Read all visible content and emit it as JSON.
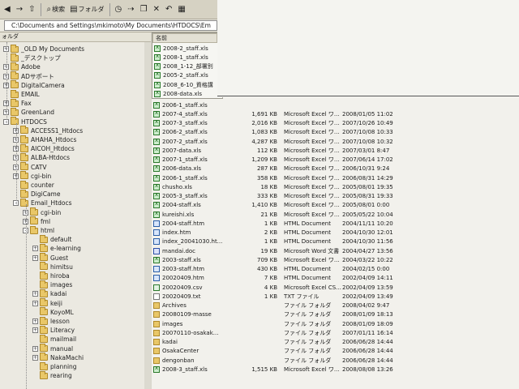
{
  "toolbar": {
    "back_label": "",
    "search_label": "検索",
    "folders_label": "フォルダ"
  },
  "address": {
    "label": "",
    "value": "C:\\Documents and Settings\\mkimoto\\My Documents\\HTDOCS\\Em"
  },
  "tree": {
    "header": "ォルダ",
    "items": [
      {
        "label": "_OLD My Documents",
        "indent": 0,
        "expander": "+"
      },
      {
        "label": "_デスクトップ",
        "indent": 0,
        "expander": ""
      },
      {
        "label": "Adobe",
        "indent": 0,
        "expander": "+"
      },
      {
        "label": "ADサポート",
        "indent": 0,
        "expander": "+"
      },
      {
        "label": "DigitalCamera",
        "indent": 0,
        "expander": "+"
      },
      {
        "label": "EMAIL",
        "indent": 0,
        "expander": ""
      },
      {
        "label": "Fax",
        "indent": 0,
        "expander": "+"
      },
      {
        "label": "GreenLand",
        "indent": 0,
        "expander": "+"
      },
      {
        "label": "HTDOCS",
        "indent": 0,
        "expander": "-"
      },
      {
        "label": "ACCESS1_Htdocs",
        "indent": 1,
        "expander": "+"
      },
      {
        "label": "AHAHA_Htdocs",
        "indent": 1,
        "expander": "+"
      },
      {
        "label": "AICOH_Htdocs",
        "indent": 1,
        "expander": "+"
      },
      {
        "label": "ALBA-Htdocs",
        "indent": 1,
        "expander": "+"
      },
      {
        "label": "CATV",
        "indent": 1,
        "expander": "+"
      },
      {
        "label": "cgi-bin",
        "indent": 1,
        "expander": "+"
      },
      {
        "label": "counter",
        "indent": 1,
        "expander": ""
      },
      {
        "label": "DigiCame",
        "indent": 1,
        "expander": ""
      },
      {
        "label": "Email_Htdocs",
        "indent": 1,
        "expander": "-"
      },
      {
        "label": "cgi-bin",
        "indent": 2,
        "expander": "+"
      },
      {
        "label": "fml",
        "indent": 2,
        "expander": "+"
      },
      {
        "label": "html",
        "indent": 2,
        "expander": "-"
      },
      {
        "label": "default",
        "indent": 3,
        "expander": ""
      },
      {
        "label": "e-learning",
        "indent": 3,
        "expander": "+"
      },
      {
        "label": "Guest",
        "indent": 3,
        "expander": "+"
      },
      {
        "label": "himitsu",
        "indent": 3,
        "expander": ""
      },
      {
        "label": "hiroba",
        "indent": 3,
        "expander": ""
      },
      {
        "label": "images",
        "indent": 3,
        "expander": ""
      },
      {
        "label": "kadai",
        "indent": 3,
        "expander": "+"
      },
      {
        "label": "keiji",
        "indent": 3,
        "expander": "+"
      },
      {
        "label": "KoyoML",
        "indent": 3,
        "expander": ""
      },
      {
        "label": "lesson",
        "indent": 3,
        "expander": "+"
      },
      {
        "label": "Literacy",
        "indent": 3,
        "expander": "+"
      },
      {
        "label": "mailmail",
        "indent": 3,
        "expander": ""
      },
      {
        "label": "manual",
        "indent": 3,
        "expander": "+"
      },
      {
        "label": "NakaMachi",
        "indent": 3,
        "expander": "+"
      },
      {
        "label": "planning",
        "indent": 3,
        "expander": ""
      },
      {
        "label": "rearing",
        "indent": 3,
        "expander": ""
      }
    ]
  },
  "list": {
    "header_name": "名前",
    "overlay_files": [
      "2008-2_staff.xls",
      "2008-1_staff.xls",
      "2008_1-12_部署別",
      "2005-2_staff.xls",
      "2008_6-10_資格講",
      "2008-data.xls"
    ],
    "rows": [
      {
        "icon": "xls",
        "name": "2006-1_staff.xls",
        "size": "",
        "type": "",
        "date": ""
      },
      {
        "icon": "xls",
        "name": "2007-4_staff.xls",
        "size": "1,691 KB",
        "type": "Microsoft Excel ワ...",
        "date": "2008/01/05 11:02"
      },
      {
        "icon": "xls",
        "name": "2007-3_staff.xls",
        "size": "2,016 KB",
        "type": "Microsoft Excel ワ...",
        "date": "2007/10/26 10:49"
      },
      {
        "icon": "xls",
        "name": "2006-2_staff.xls",
        "size": "1,083 KB",
        "type": "Microsoft Excel ワ...",
        "date": "2007/10/08 10:33"
      },
      {
        "icon": "xls",
        "name": "2007-2_staff.xls",
        "size": "4,287 KB",
        "type": "Microsoft Excel ワ...",
        "date": "2007/10/08 10:32"
      },
      {
        "icon": "xls",
        "name": "2007-data.xls",
        "size": "112 KB",
        "type": "Microsoft Excel ワ...",
        "date": "2007/03/01 8:47"
      },
      {
        "icon": "xls",
        "name": "2007-1_staff.xls",
        "size": "1,209 KB",
        "type": "Microsoft Excel ワ...",
        "date": "2007/06/14 17:02"
      },
      {
        "icon": "xls",
        "name": "2006-data.xls",
        "size": "287 KB",
        "type": "Microsoft Excel ワ...",
        "date": "2006/10/31 9:24"
      },
      {
        "icon": "xls",
        "name": "2006-1_staff.xls",
        "size": "358 KB",
        "type": "Microsoft Excel ワ...",
        "date": "2006/08/31 14:29"
      },
      {
        "icon": "xls",
        "name": "chusho.xls",
        "size": "18 KB",
        "type": "Microsoft Excel ワ...",
        "date": "2005/08/01 19:35"
      },
      {
        "icon": "xls",
        "name": "2005-3_staff.xls",
        "size": "333 KB",
        "type": "Microsoft Excel ワ...",
        "date": "2005/08/31 19:33"
      },
      {
        "icon": "xls",
        "name": "2004-staff.xls",
        "size": "1,410 KB",
        "type": "Microsoft Excel ワ...",
        "date": "2005/08/01 0:00"
      },
      {
        "icon": "xls",
        "name": "kureishi.xls",
        "size": "21 KB",
        "type": "Microsoft Excel ワ...",
        "date": "2005/05/22 10:04"
      },
      {
        "icon": "htm",
        "name": "2004-staff.htm",
        "size": "1 KB",
        "type": "HTML Document",
        "date": "2004/11/11 10:20"
      },
      {
        "icon": "htm",
        "name": "index.htm",
        "size": "2 KB",
        "type": "HTML Document",
        "date": "2004/10/30 12:01"
      },
      {
        "icon": "htm",
        "name": "index_20041030.ht...",
        "size": "1 KB",
        "type": "HTML Document",
        "date": "2004/10/30 11:56"
      },
      {
        "icon": "doc",
        "name": "mandai.doc",
        "size": "19 KB",
        "type": "Microsoft Word 文書",
        "date": "2004/04/27 13:56"
      },
      {
        "icon": "xls",
        "name": "2003-staff.xls",
        "size": "709 KB",
        "type": "Microsoft Excel ワ...",
        "date": "2004/03/22 10:22"
      },
      {
        "icon": "htm",
        "name": "2003-staff.htm",
        "size": "430 KB",
        "type": "HTML Document",
        "date": "2004/02/15 0:00"
      },
      {
        "icon": "htm",
        "name": "20020409.htm",
        "size": "7 KB",
        "type": "HTML Document",
        "date": "2002/04/09 14:11"
      },
      {
        "icon": "csv",
        "name": "20020409.csv",
        "size": "4 KB",
        "type": "Microsoft Excel CS...",
        "date": "2002/04/09 13:59"
      },
      {
        "icon": "txt",
        "name": "20020409.txt",
        "size": "1 KB",
        "type": "TXT ファイル",
        "date": "2002/04/09 13:49"
      },
      {
        "icon": "folder2",
        "name": "Archives",
        "size": "",
        "type": "ファイル フォルダ",
        "date": "2008/04/02 9:47"
      },
      {
        "icon": "folder2",
        "name": "20080109-masse",
        "size": "",
        "type": "ファイル フォルダ",
        "date": "2008/01/09 18:13"
      },
      {
        "icon": "folder2",
        "name": "images",
        "size": "",
        "type": "ファイル フォルダ",
        "date": "2008/01/09 18:09"
      },
      {
        "icon": "folder2",
        "name": "20070110-osakak...",
        "size": "",
        "type": "ファイル フォルダ",
        "date": "2007/01/11 16:14"
      },
      {
        "icon": "folder2",
        "name": "kadai",
        "size": "",
        "type": "ファイル フォルダ",
        "date": "2006/06/28 14:44"
      },
      {
        "icon": "folder2",
        "name": "OsakaCenter",
        "size": "",
        "type": "ファイル フォルダ",
        "date": "2006/06/28 14:44"
      },
      {
        "icon": "folder2",
        "name": "dengonban",
        "size": "",
        "type": "ファイル フォルダ",
        "date": "2006/06/28 14:44"
      },
      {
        "icon": "xls",
        "name": "2008-3_staff.xls",
        "size": "1,515 KB",
        "type": "Microsoft Excel ワ...",
        "date": "2008/08/08 13:26"
      }
    ]
  }
}
